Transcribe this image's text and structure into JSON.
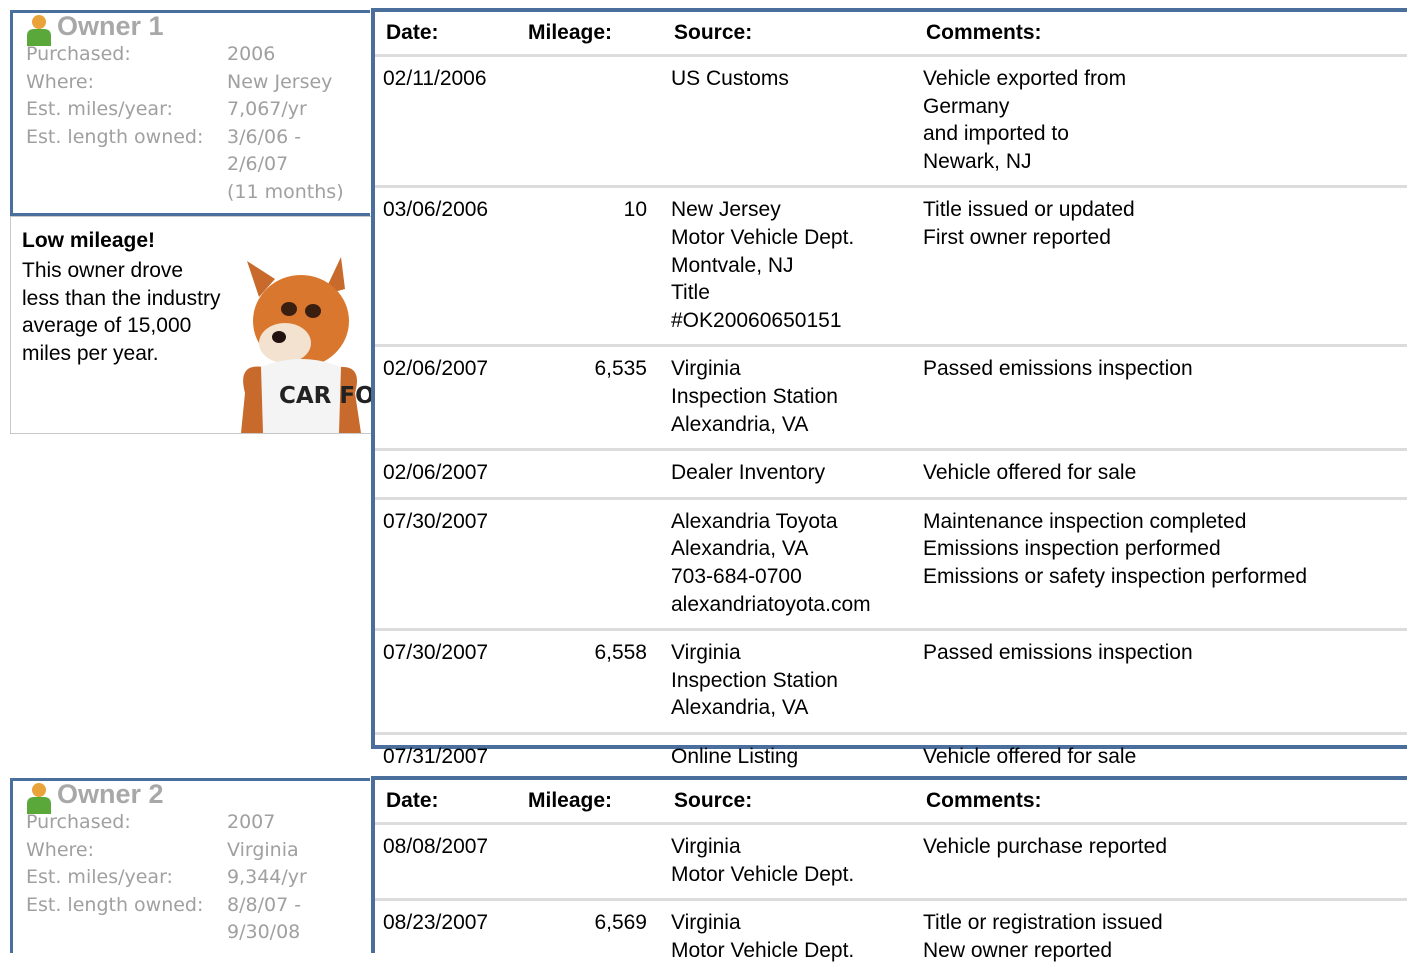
{
  "columns": {
    "date": "Date:",
    "mileage": "Mileage:",
    "source": "Source:",
    "comments": "Comments:"
  },
  "owners": [
    {
      "title": "Owner 1",
      "info": [
        {
          "label": "Purchased:",
          "value": "2006"
        },
        {
          "label": "Where:",
          "value": "New Jersey"
        },
        {
          "label": "Est. miles/year:",
          "value": "7,067/yr"
        },
        {
          "label": "Est. length owned:",
          "value": "3/6/06 -\n2/6/07\n(11 months)"
        }
      ],
      "note": {
        "title": "Low mileage!",
        "text": "This owner drove less than the industry average of 15,000 miles per year."
      },
      "records": [
        {
          "date": "02/11/2006",
          "mileage": "",
          "source": "US Customs",
          "comments": "Vehicle exported from\nGermany\nand imported to\nNewark, NJ"
        },
        {
          "date": "03/06/2006",
          "mileage": "10",
          "source": "New Jersey\nMotor Vehicle Dept.\nMontvale, NJ\nTitle\n#OK20060650151",
          "comments": "Title issued or updated\nFirst owner reported"
        },
        {
          "date": "02/06/2007",
          "mileage": "6,535",
          "source": "Virginia\nInspection Station\nAlexandria, VA",
          "comments": "Passed emissions inspection"
        },
        {
          "date": "02/06/2007",
          "mileage": "",
          "source": "Dealer Inventory",
          "comments": "Vehicle offered for sale"
        },
        {
          "date": "07/30/2007",
          "mileage": "",
          "source": "Alexandria Toyota\nAlexandria, VA\n703-684-0700\nalexandriatoyota.com",
          "comments": "Maintenance inspection completed\nEmissions inspection performed\nEmissions or safety inspection performed"
        },
        {
          "date": "07/30/2007",
          "mileage": "6,558",
          "source": "Virginia\nInspection Station\nAlexandria, VA",
          "comments": "Passed emissions inspection"
        },
        {
          "date": "07/31/2007",
          "mileage": "",
          "source": "Online Listing",
          "comments": "Vehicle offered for sale"
        }
      ]
    },
    {
      "title": "Owner 2",
      "info": [
        {
          "label": "Purchased:",
          "value": "2007"
        },
        {
          "label": "Where:",
          "value": "Virginia"
        },
        {
          "label": "Est. miles/year:",
          "value": "9,344/yr"
        },
        {
          "label": "Est. length owned:",
          "value": "8/8/07 -\n9/30/08"
        }
      ],
      "records": [
        {
          "date": "08/08/2007",
          "mileage": "",
          "source": "Virginia\nMotor Vehicle Dept.",
          "comments": "Vehicle purchase reported"
        },
        {
          "date": "08/23/2007",
          "mileage": "6,569",
          "source": "Virginia\nMotor Vehicle Dept.",
          "comments": "Title or registration issued\nNew owner reported"
        }
      ]
    }
  ],
  "fox_shirt_text": "CAR FOX"
}
